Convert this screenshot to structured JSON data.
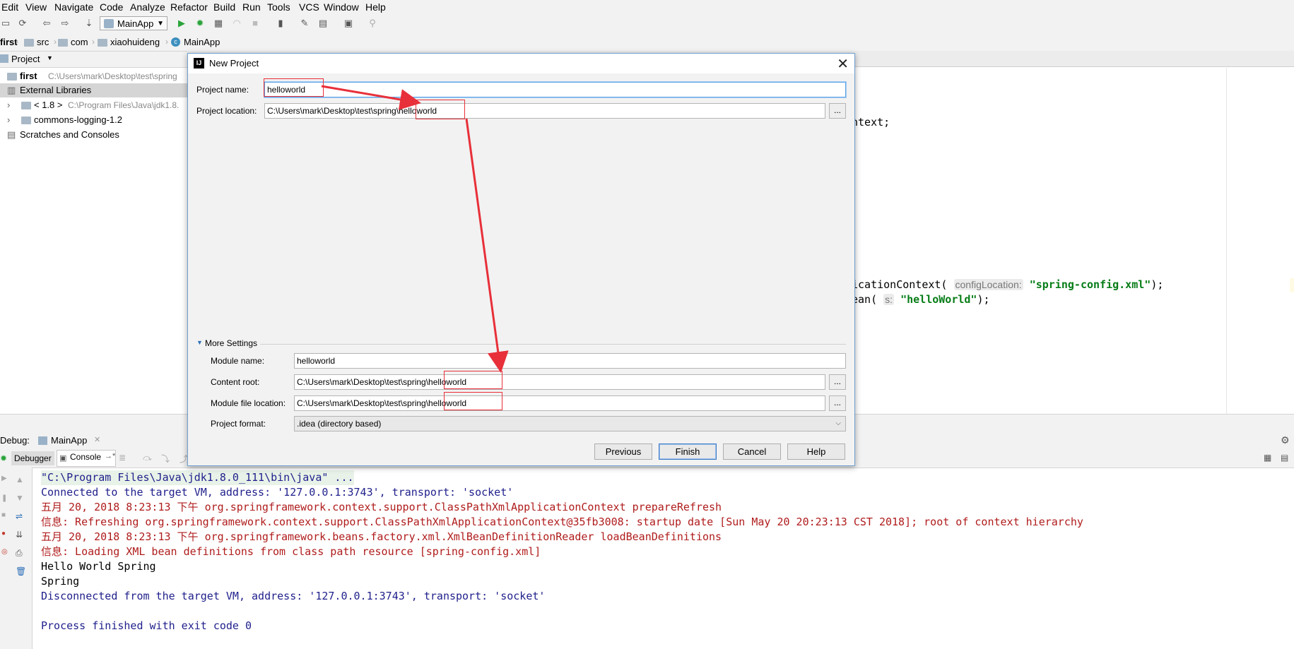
{
  "menu": [
    "Edit",
    "View",
    "Navigate",
    "Code",
    "Analyze",
    "Refactor",
    "Build",
    "Run",
    "Tools",
    "VCS",
    "Window",
    "Help"
  ],
  "toolbar": {
    "run_config": "MainApp"
  },
  "breadcrumbs": [
    "first",
    "src",
    "com",
    "xiaohuideng",
    "MainApp"
  ],
  "project_panel": {
    "title": "Project",
    "tree": [
      {
        "name": "first",
        "path": "C:\\Users\\mark\\Desktop\\test\\spring"
      },
      {
        "name": "External Libraries",
        "path": ""
      },
      {
        "name": "< 1.8 >",
        "path": "C:\\Program Files\\Java\\jdk1.8."
      },
      {
        "name": "commons-logging-1.2",
        "path": ""
      },
      {
        "name": "Scratches and Consoles",
        "path": ""
      }
    ]
  },
  "editor": {
    "line1": "ntext;",
    "line2_pre": "icationContext(",
    "line2_hint": "configLocation:",
    "line2_str": "\"spring-config.xml\"",
    "line2_post": ");",
    "line3_pre": "ean(",
    "line3_hint": "s:",
    "line3_str": "\"helloWorld\"",
    "line3_post": ");"
  },
  "dialog": {
    "title": "New Project",
    "project_name_label": "Project name:",
    "project_name_value": "helloworld",
    "project_location_label": "Project location:",
    "project_location_value": "C:\\Users\\mark\\Desktop\\test\\spring\\helloworld",
    "more_settings": "More Settings",
    "module_name_label": "Module name:",
    "module_name_value": "helloworld",
    "content_root_label": "Content root:",
    "content_root_value": "C:\\Users\\mark\\Desktop\\test\\spring\\helloworld",
    "module_file_label": "Module file location:",
    "module_file_value": "C:\\Users\\mark\\Desktop\\test\\spring\\helloworld",
    "project_format_label": "Project format:",
    "project_format_value": ".idea (directory based)",
    "browse": "...",
    "buttons": {
      "previous": "Previous",
      "finish": "Finish",
      "cancel": "Cancel",
      "help": "Help"
    }
  },
  "debug": {
    "label": "Debug:",
    "session": "MainApp",
    "tabs": {
      "debugger": "Debugger",
      "console": "Console"
    }
  },
  "console": {
    "lines": [
      {
        "text": "\"C:\\Program Files\\Java\\jdk1.8.0_111\\bin\\java\" ...",
        "color": "#1f1f8c"
      },
      {
        "text": "Connected to the target VM, address: '127.0.0.1:3743', transport: 'socket'",
        "color": "#1f1f8c"
      },
      {
        "text": "五月 20, 2018 8:23:13 下午 org.springframework.context.support.ClassPathXmlApplicationContext prepareRefresh",
        "color": "#b01c1c"
      },
      {
        "text": "信息: Refreshing org.springframework.context.support.ClassPathXmlApplicationContext@35fb3008: startup date [Sun May 20 20:23:13 CST 2018]; root of context hierarchy",
        "color": "#b01c1c"
      },
      {
        "text": "五月 20, 2018 8:23:13 下午 org.springframework.beans.factory.xml.XmlBeanDefinitionReader loadBeanDefinitions",
        "color": "#b01c1c"
      },
      {
        "text": "信息: Loading XML bean definitions from class path resource [spring-config.xml]",
        "color": "#b01c1c"
      },
      {
        "text": "Hello World Spring",
        "color": "#000000"
      },
      {
        "text": "Spring",
        "color": "#000000"
      },
      {
        "text": "Disconnected from the target VM, address: '127.0.0.1:3743', transport: 'socket'",
        "color": "#1f1f8c"
      },
      {
        "text": "",
        "color": "#000000"
      },
      {
        "text": "Process finished with exit code 0",
        "color": "#1f1f8c"
      }
    ]
  },
  "colors": {
    "annotation": "#e8303a",
    "focus": "#5ba3e8",
    "editor_string": "#067d17"
  }
}
